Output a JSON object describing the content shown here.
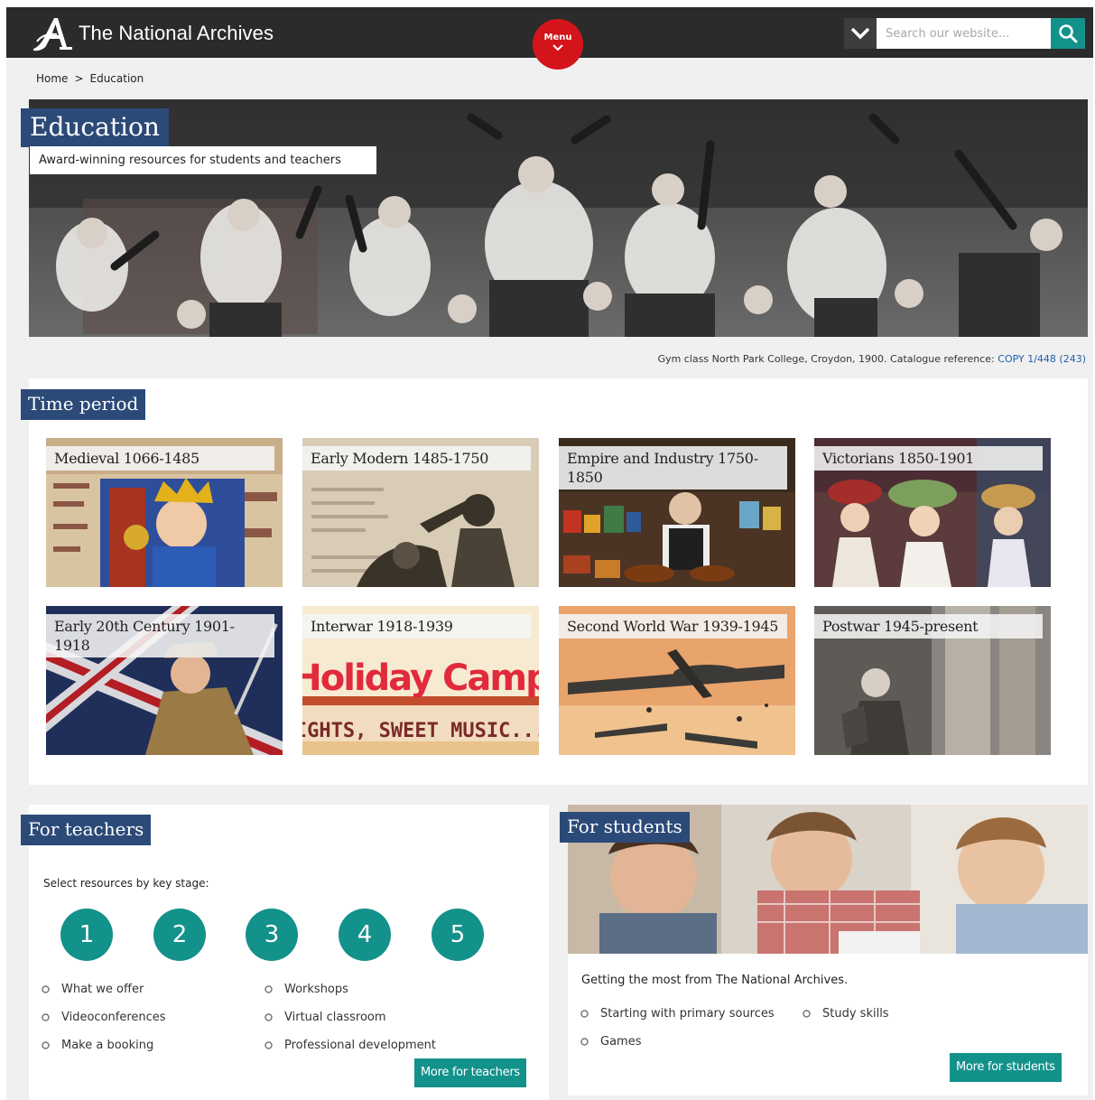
{
  "header": {
    "logo_text": "The National Archives",
    "menu_label": "Menu",
    "search_placeholder": "Search our website..."
  },
  "breadcrumb": {
    "home": "Home",
    "separator": ">",
    "current": "Education"
  },
  "hero": {
    "title": "Education",
    "subtitle": "Award-winning resources for students and teachers",
    "caption_text": "Gym class North Park College, Croydon, 1900. Catalogue reference:",
    "caption_link": "COPY 1/448 (243)"
  },
  "time_period": {
    "title": "Time period",
    "cards": [
      {
        "label": "Medieval 1066-1485"
      },
      {
        "label": "Early Modern 1485-1750"
      },
      {
        "label": "Empire and Industry 1750-1850"
      },
      {
        "label": "Victorians 1850-1901"
      },
      {
        "label": "Early 20th Century 1901-1918"
      },
      {
        "label": "Interwar 1918-1939"
      },
      {
        "label": "Second World War 1939-1945"
      },
      {
        "label": "Postwar 1945-present"
      }
    ],
    "interwar_poster_top": "Holiday Camp",
    "interwar_poster_bottom": "LIGHTS, SWEET MUSIC...."
  },
  "teachers": {
    "title": "For teachers",
    "intro": "Select resources by key stage:",
    "key_stages": [
      "1",
      "2",
      "3",
      "4",
      "5"
    ],
    "links_left": [
      "What we offer",
      "Videoconferences",
      "Make a booking"
    ],
    "links_right": [
      "Workshops",
      "Virtual classroom",
      "Professional development"
    ],
    "more_button": "More for teachers"
  },
  "students": {
    "title": "For students",
    "intro": "Getting the most from The National Archives.",
    "links_row1": [
      "Starting with primary sources",
      "Study skills"
    ],
    "links_row2": [
      "Games"
    ],
    "more_button": "More for students"
  },
  "colors": {
    "header_bg": "#2b2b2b",
    "menu_red": "#d3141a",
    "teal": "#13918b",
    "title_blue": "#2c4a78",
    "link_blue": "#1f5ea8"
  },
  "icons": [
    "logo-a-icon",
    "chevron-down-icon",
    "search-icon",
    "bullet-icon"
  ]
}
